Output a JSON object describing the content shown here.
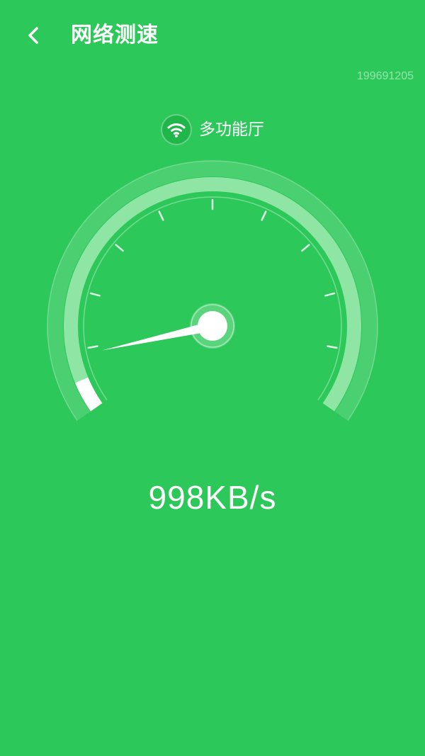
{
  "header": {
    "title": "网络测速",
    "back_icon": "chevron-left-icon"
  },
  "device_id": "199691205",
  "network": {
    "icon": "wifi-icon",
    "name": "多功能厅"
  },
  "gauge": {
    "level": 0.05,
    "tick_count": 9
  },
  "speed": {
    "value": "998KB/s"
  },
  "colors": {
    "background": "#2dc85a",
    "gauge_track": "#8fe6a4",
    "gauge_fill": "#ffffff",
    "needle": "#ffffff"
  }
}
